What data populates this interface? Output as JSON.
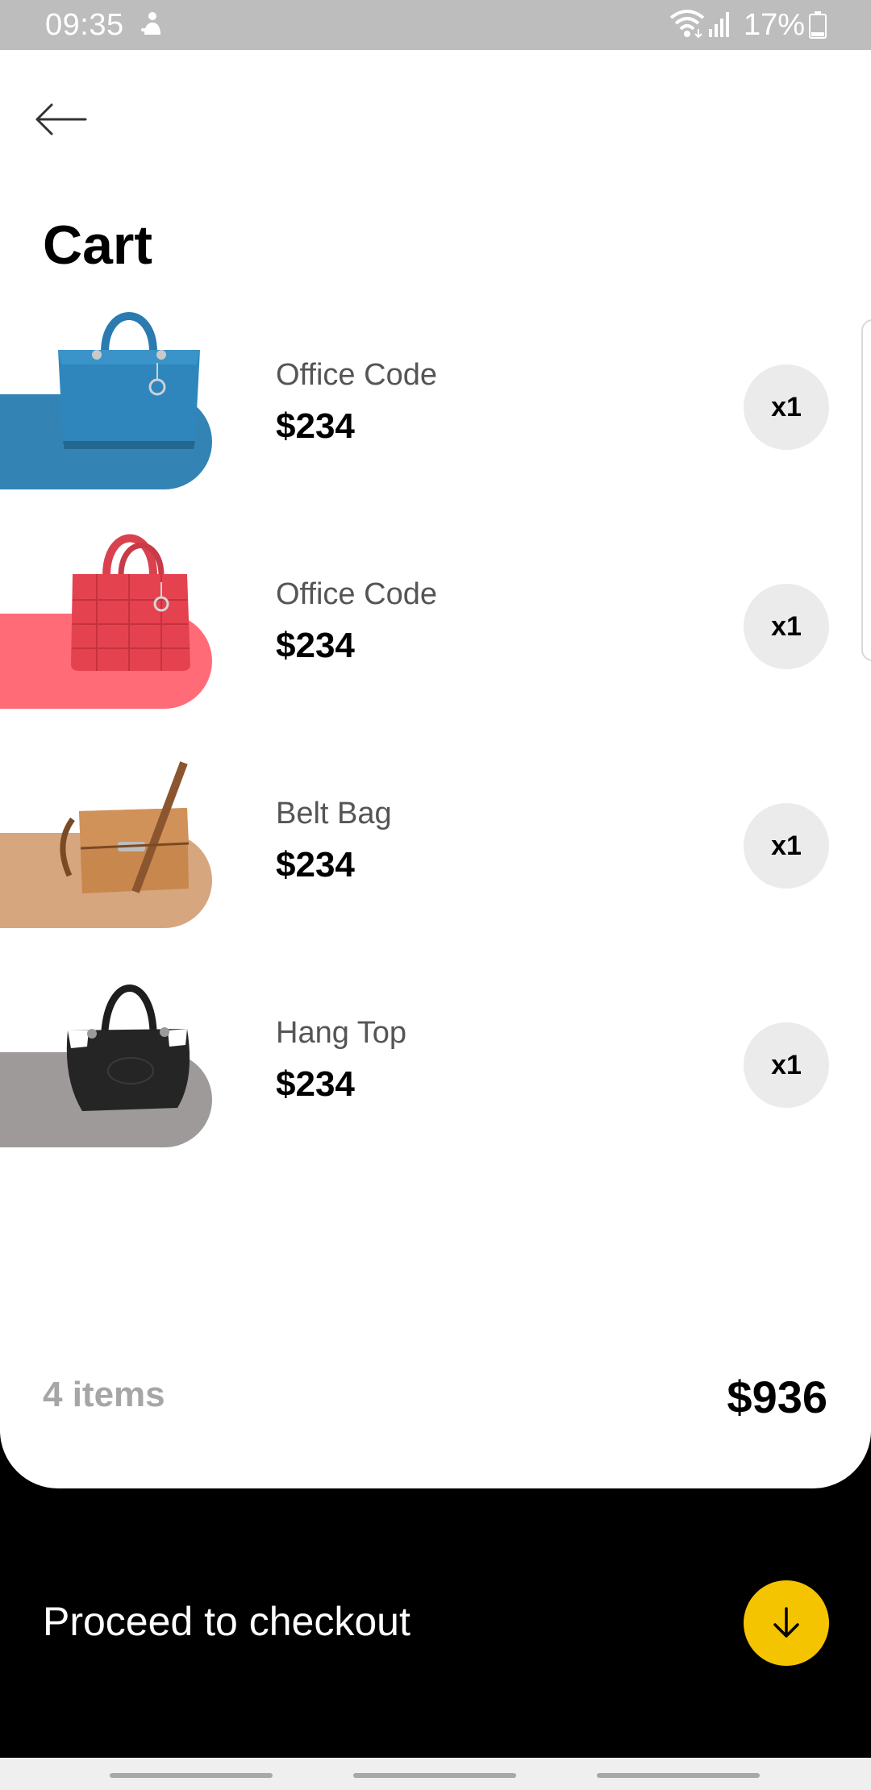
{
  "status_bar": {
    "time": "09:35",
    "battery": "17%"
  },
  "header": {
    "title": "Cart",
    "back_icon": "arrow-left-icon"
  },
  "cart": {
    "items": [
      {
        "name": "Office Code",
        "price": "$234",
        "quantity": "x1",
        "swatch_color": "#3383b5",
        "image": "blue-handbag-image"
      },
      {
        "name": "Office Code",
        "price": "$234",
        "quantity": "x1",
        "swatch_color": "#ff6c78",
        "image": "red-handbag-image"
      },
      {
        "name": "Belt Bag",
        "price": "$234",
        "quantity": "x1",
        "swatch_color": "#d6a67f",
        "image": "brown-shoulder-bag-image"
      },
      {
        "name": "Hang Top",
        "price": "$234",
        "quantity": "x1",
        "swatch_color": "#9e9a9a",
        "image": "black-handbag-image"
      }
    ]
  },
  "summary": {
    "count": "4 items",
    "total": "$936"
  },
  "checkout": {
    "label": "Proceed to checkout",
    "icon": "arrow-down-icon",
    "button_color": "#f5c400"
  }
}
